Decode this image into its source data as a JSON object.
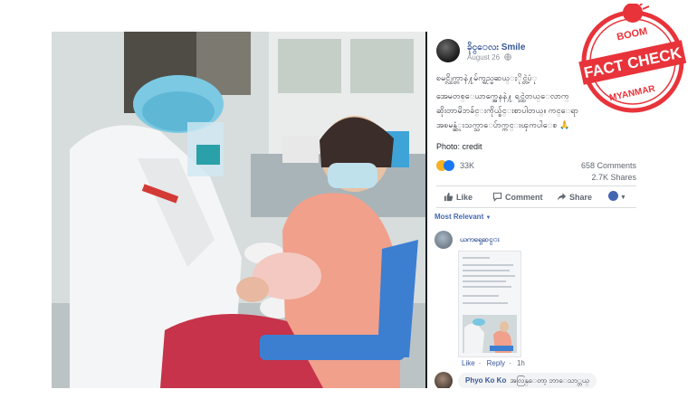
{
  "post": {
    "author": "ခိုင္ေလး Smile",
    "date": "August 26",
    "text_lines": [
      "ၿမင္လိုက္တာနဲ႔မ်က္ရည္မဆယ္ႏိုင္တဲ့ပံု",
      "အေမတစ္ေယာက္အေနနဲ႔ ရင္ထဲတယ္ေလာက္",
      "ဆိုးတာမိဘခ်င္းကိုယ္ခ်င္းစာပါတယ္။ ကင္ေရာ",
      "အၿမန္ဆံုးသက္သာေပ်ာက္ကင္းၾကပါေစ 🙏"
    ],
    "credit": "Photo: credit"
  },
  "stats": {
    "reactions": "33K",
    "comments": "658 Comments",
    "shares": "2.7K Shares"
  },
  "actions": {
    "like": "Like",
    "comment": "Comment",
    "share": "Share"
  },
  "filter": {
    "label": "Most Relevant"
  },
  "comments": [
    {
      "name": "ယကၡေဆင္း",
      "like_label": "Like",
      "reply_label": "Reply",
      "time": "1h"
    },
    {
      "name": "Phyo Ko Ko",
      "text": "အလြန္ေတာ့ ဘာေသာ္ဘယ္"
    }
  ],
  "badge": {
    "top": "BOOM",
    "main": "FACT CHECK",
    "bottom": "MYANMAR",
    "color": "#e8333a"
  },
  "colors": {
    "link": "#385898",
    "like_blue": "#1877f2",
    "panel_bg": "#ffffff",
    "photo_frame": "#1c1e21"
  }
}
